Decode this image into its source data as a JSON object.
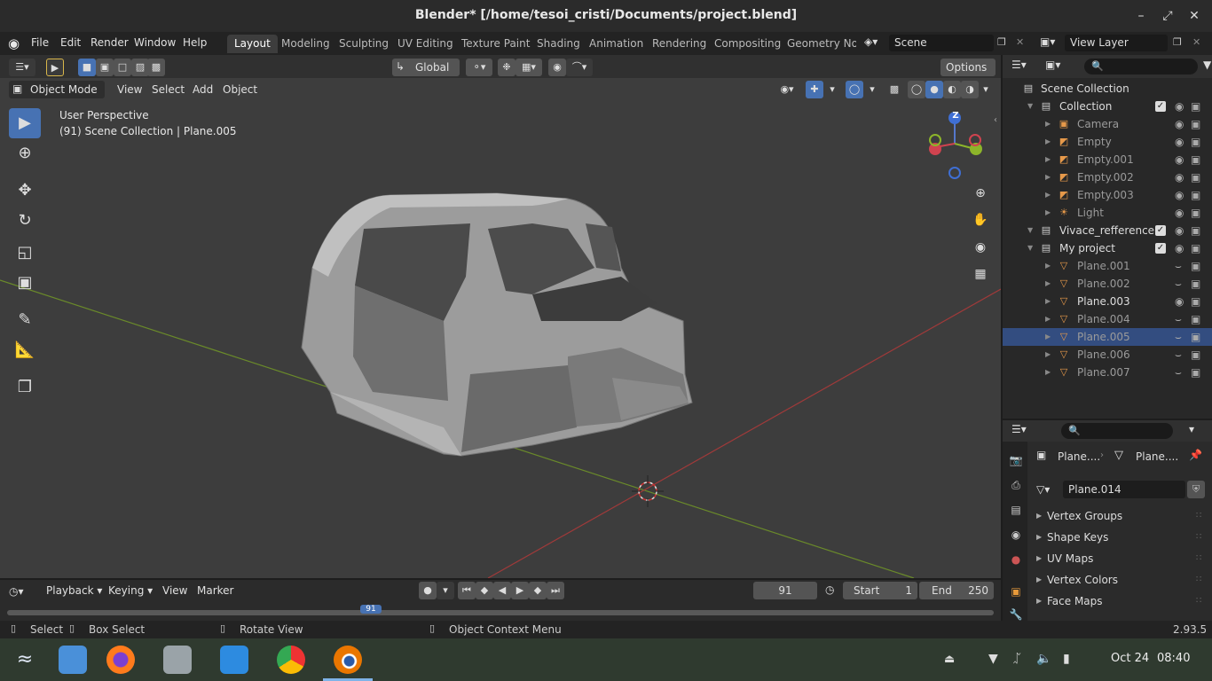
{
  "window": {
    "title": "Blender* [/home/tesoi_cristi/Documents/project.blend]"
  },
  "menus": [
    "File",
    "Edit",
    "Render",
    "Window",
    "Help"
  ],
  "workspaces": [
    "Layout",
    "Modeling",
    "Sculpting",
    "UV Editing",
    "Texture Paint",
    "Shading",
    "Animation",
    "Rendering",
    "Compositing",
    "Geometry Nod"
  ],
  "scene": {
    "name": "Scene",
    "view_layer": "View Layer"
  },
  "tool_header": {
    "orientation": "Global",
    "options_label": "Options"
  },
  "viewport_header": {
    "mode": "Object Mode",
    "menus": [
      "View",
      "Select",
      "Add",
      "Object"
    ]
  },
  "viewport": {
    "perspective": "User Perspective",
    "info": "(91) Scene Collection | Plane.005",
    "axis_z": "Z"
  },
  "outliner": {
    "root": "Scene Collection",
    "rows": [
      {
        "label": "Collection",
        "indent": 1,
        "type": "collection"
      },
      {
        "label": "Camera",
        "indent": 2,
        "type": "camera"
      },
      {
        "label": "Empty",
        "indent": 2,
        "type": "empty"
      },
      {
        "label": "Empty.001",
        "indent": 2,
        "type": "empty"
      },
      {
        "label": "Empty.002",
        "indent": 2,
        "type": "empty"
      },
      {
        "label": "Empty.003",
        "indent": 2,
        "type": "empty"
      },
      {
        "label": "Light",
        "indent": 2,
        "type": "light"
      },
      {
        "label": "Vivace_refference",
        "indent": 1,
        "type": "collection"
      },
      {
        "label": "My project",
        "indent": 1,
        "type": "collection"
      },
      {
        "label": "Plane.001",
        "indent": 2,
        "type": "mesh"
      },
      {
        "label": "Plane.002",
        "indent": 2,
        "type": "mesh"
      },
      {
        "label": "Plane.003",
        "indent": 2,
        "type": "mesh"
      },
      {
        "label": "Plane.004",
        "indent": 2,
        "type": "mesh"
      },
      {
        "label": "Plane.005",
        "indent": 2,
        "type": "mesh",
        "selected": true
      },
      {
        "label": "Plane.006",
        "indent": 2,
        "type": "mesh"
      },
      {
        "label": "Plane.007",
        "indent": 2,
        "type": "mesh"
      }
    ]
  },
  "properties": {
    "breadcrumb_object": "Plane....",
    "breadcrumb_data": "Plane....",
    "mesh_name": "Plane.014",
    "panels": [
      "Vertex Groups",
      "Shape Keys",
      "UV Maps",
      "Vertex Colors",
      "Face Maps"
    ]
  },
  "timeline": {
    "menus": [
      "Playback",
      "Keying",
      "View",
      "Marker"
    ],
    "current_frame": "91",
    "start_label": "Start",
    "start": "1",
    "end_label": "End",
    "end": "250",
    "ruler_marker": "91"
  },
  "statusbar": {
    "select": "Select",
    "box_select": "Box Select",
    "rotate_view": "Rotate View",
    "context_menu": "Object Context Menu",
    "version": "2.93.5"
  },
  "taskbar": {
    "date": "Oct 24",
    "time": "08:40"
  },
  "colors": {
    "accent": "#4772b3",
    "selection": "#334d80",
    "x_axis": "#a03a3a",
    "y_axis": "#6a8a2a"
  }
}
